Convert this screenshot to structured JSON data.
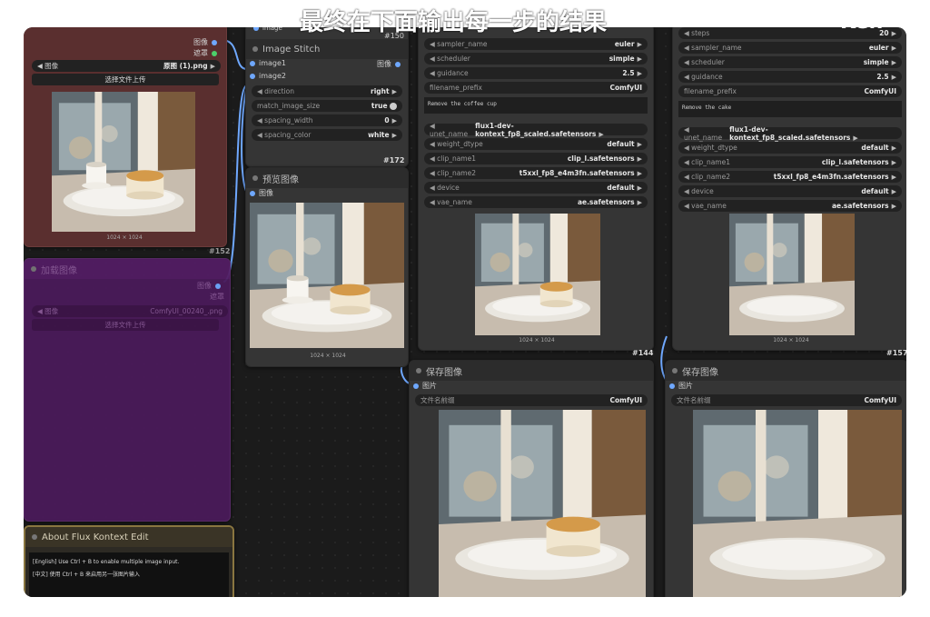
{
  "overlay_title": "最终在下面输出每一步的结果",
  "overlay_right": "Ken",
  "load_image": {
    "out1": "图像",
    "out2": "遮罩",
    "image_label": "图像",
    "image_value": "原图 (1).png",
    "upload_button": "选择文件上传",
    "caption": "1024 × 1024",
    "node_id": "#152"
  },
  "load_image2": {
    "title": "加载图像",
    "out1": "图像",
    "out2": "遮罩",
    "image_label": "图像",
    "image_value": "ComfyUI_00240_.png",
    "upload_button": "选择文件上传"
  },
  "about": {
    "title": "About Flux Kontext Edit",
    "line_en": "[English] Use Ctrl + B to enable multiple image input.",
    "line_zh": "[中文] 使用 Ctrl + B 来启用另一张图片输入"
  },
  "image_stitch": {
    "top_tag": "image",
    "node_id_top": "#150",
    "title": "Image Stitch",
    "in1": "image1",
    "in2": "image2",
    "out": "图像",
    "rows": [
      {
        "k": "direction",
        "v": "right"
      },
      {
        "k": "match_image_size",
        "v": "true"
      },
      {
        "k": "spacing_width",
        "v": "0"
      },
      {
        "k": "spacing_color",
        "v": "white"
      }
    ],
    "node_id": "#172"
  },
  "preview": {
    "title": "预览图像",
    "input": "图像",
    "caption": "1024 × 1024"
  },
  "left_group": {
    "rows_top": [
      {
        "k": "sampler_name",
        "v": "euler"
      },
      {
        "k": "scheduler",
        "v": "simple"
      },
      {
        "k": "guidance",
        "v": "2.5"
      },
      {
        "k": "filename_prefix",
        "v": "ComfyUI"
      }
    ],
    "prompt": "Remove the coffee cup",
    "rows_model": [
      {
        "k": "unet_name",
        "v": "flux1-dev-kontext_fp8_scaled.safetensors"
      },
      {
        "k": "weight_dtype",
        "v": "default"
      },
      {
        "k": "clip_name1",
        "v": "clip_l.safetensors"
      },
      {
        "k": "clip_name2",
        "v": "t5xxl_fp8_e4m3fn.safetensors"
      },
      {
        "k": "device",
        "v": "default"
      },
      {
        "k": "vae_name",
        "v": "ae.safetensors"
      }
    ],
    "caption": "1024 × 1024",
    "node_id": "#144",
    "save_title": "保存图像",
    "save_input": "图片",
    "save_prefix_k": "文件名前缀",
    "save_prefix_v": "ComfyUI"
  },
  "right_group": {
    "rows_top": [
      {
        "k": "steps",
        "v": "20"
      },
      {
        "k": "sampler_name",
        "v": "euler"
      },
      {
        "k": "scheduler",
        "v": "simple"
      },
      {
        "k": "guidance",
        "v": "2.5"
      },
      {
        "k": "filename_prefix",
        "v": "ComfyUI"
      }
    ],
    "prompt": "Remove the cake",
    "rows_model": [
      {
        "k": "unet_name",
        "v": "flux1-dev-kontext_fp8_scaled.safetensors"
      },
      {
        "k": "weight_dtype",
        "v": "default"
      },
      {
        "k": "clip_name1",
        "v": "clip_l.safetensors"
      },
      {
        "k": "clip_name2",
        "v": "t5xxl_fp8_e4m3fn.safetensors"
      },
      {
        "k": "device",
        "v": "default"
      },
      {
        "k": "vae_name",
        "v": "ae.safetensors"
      }
    ],
    "caption": "1024 × 1024",
    "node_id": "#157",
    "save_title": "保存图像",
    "save_input": "图片",
    "save_prefix_k": "文件名前缀",
    "save_prefix_v": "ComfyUI"
  },
  "colors": {
    "link": "#6fa8ff",
    "load_node": "#5a2f2f",
    "purple_node": "#4a1a5a",
    "about_border": "#8a7640"
  }
}
